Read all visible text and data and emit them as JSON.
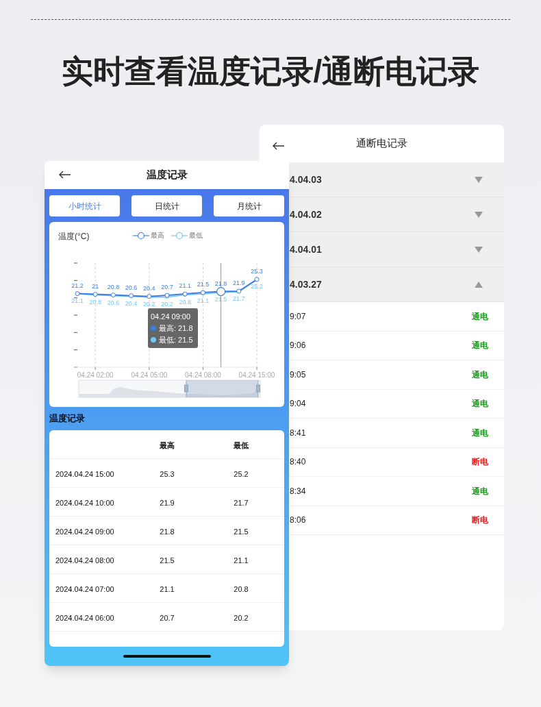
{
  "headline": "实时查看温度记录/通断电记录",
  "power_screen": {
    "title": "通断电记录",
    "groups": [
      {
        "date": "4.04.03",
        "expanded": false
      },
      {
        "date": "4.04.02",
        "expanded": false
      },
      {
        "date": "4.04.01",
        "expanded": false
      },
      {
        "date": "4.03.27",
        "expanded": true,
        "events": [
          {
            "time": "9:07",
            "status": "通电",
            "kind": "on"
          },
          {
            "time": "9:06",
            "status": "通电",
            "kind": "on"
          },
          {
            "time": "9:05",
            "status": "通电",
            "kind": "on"
          },
          {
            "time": "9:04",
            "status": "通电",
            "kind": "on"
          },
          {
            "time": "8:41",
            "status": "通电",
            "kind": "on"
          },
          {
            "time": "8:40",
            "status": "断电",
            "kind": "off"
          },
          {
            "time": "8:34",
            "status": "通电",
            "kind": "on"
          },
          {
            "time": "8:06",
            "status": "断电",
            "kind": "off"
          }
        ]
      }
    ]
  },
  "temp_screen": {
    "title": "温度记录",
    "tabs": [
      {
        "label": "小时统计",
        "selected": true
      },
      {
        "label": "日统计",
        "selected": false
      },
      {
        "label": "月统计",
        "selected": false
      }
    ],
    "chart": {
      "tooltip": {
        "title": "04.24 09:00",
        "lines": [
          "最高: 21.8",
          "最低: 21.5"
        ]
      },
      "points": [
        {
          "selected": false
        },
        {
          "selected": false
        },
        {
          "selected": false
        },
        {
          "selected": false
        },
        {
          "selected": false
        },
        {
          "selected": false
        },
        {
          "selected": false
        },
        {
          "selected": false
        },
        {
          "selected": true
        },
        {
          "selected": false
        },
        {
          "selected": false
        }
      ],
      "chart_data": {
        "type": "line",
        "title": "温度(°C)",
        "categories": [
          null,
          "04.24 02:00",
          null,
          null,
          "04.24 05:00",
          null,
          null,
          "04.24 08:00",
          null,
          null,
          "04.24 15:00"
        ],
        "ylim": [
          0,
          30
        ],
        "grid": true,
        "legend": "top",
        "series": [
          {
            "name": "最高",
            "color": "#3d7fe0",
            "marker": "circle",
            "values": [
              21.2,
              21,
              20.8,
              20.6,
              20.4,
              20.7,
              21.1,
              21.5,
              21.8,
              21.9,
              25.3
            ]
          },
          {
            "name": "最低",
            "color": "#72c6f5",
            "marker": "circle",
            "values": [
              21.1,
              20.8,
              20.6,
              20.4,
              20.2,
              20.2,
              20.8,
              21.1,
              21.5,
              21.7,
              25.2
            ]
          }
        ],
        "data_labels": true
      }
    },
    "section_title": "温度记录",
    "table": {
      "columns": [
        "",
        "最高",
        "最低"
      ],
      "rows": [
        [
          "2024.04.24 15:00",
          "25.3",
          "25.2"
        ],
        [
          "2024.04.24 10:00",
          "21.9",
          "21.7"
        ],
        [
          "2024.04.24 09:00",
          "21.8",
          "21.5"
        ],
        [
          "2024.04.24 08:00",
          "21.5",
          "21.1"
        ],
        [
          "2024.04.24 07:00",
          "21.1",
          "20.8"
        ],
        [
          "2024.04.24 06:00",
          "20.7",
          "20.2"
        ]
      ]
    }
  }
}
